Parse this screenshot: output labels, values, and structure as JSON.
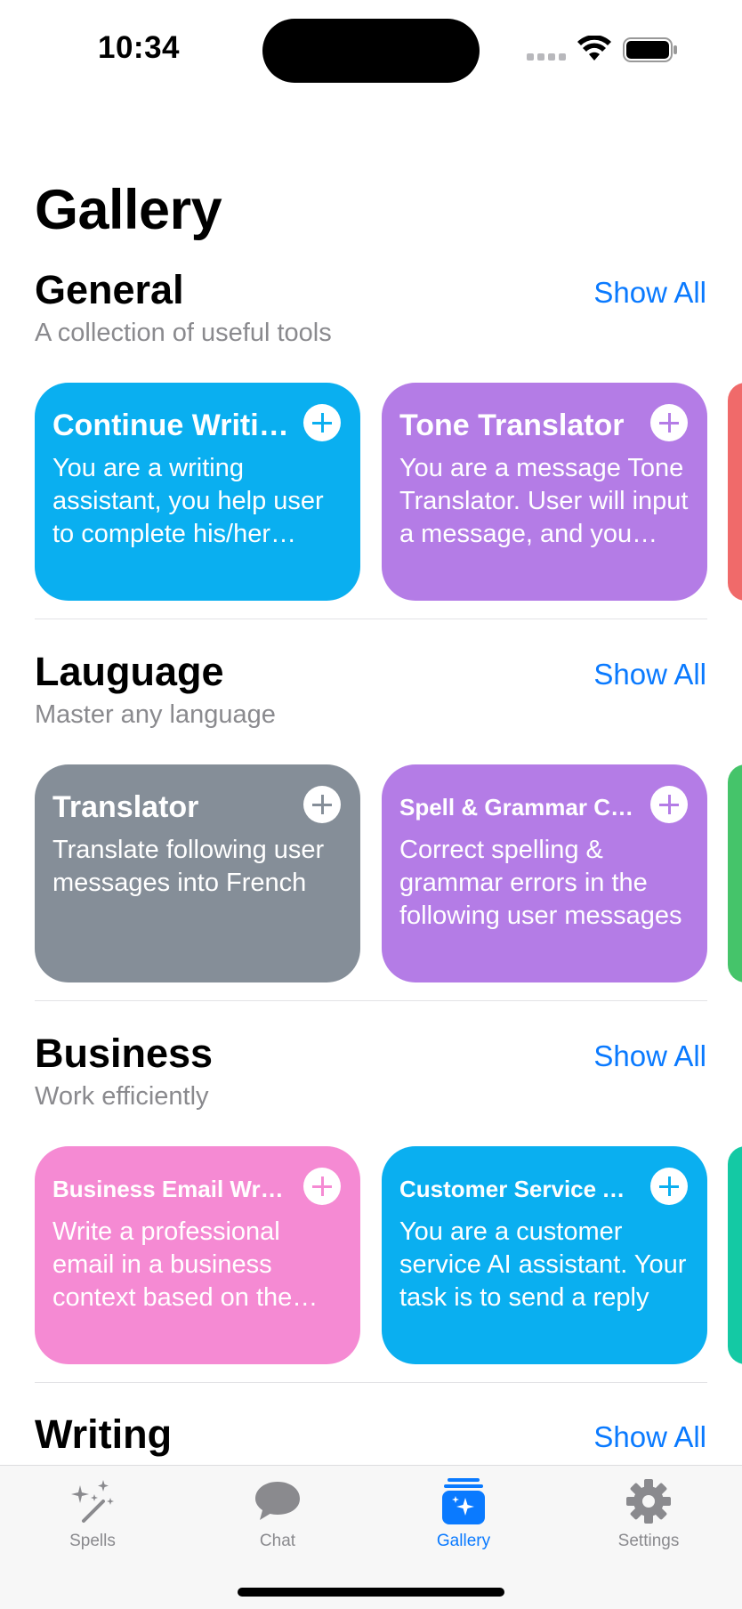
{
  "status": {
    "time": "10:34"
  },
  "page": {
    "title": "Gallery"
  },
  "sections": [
    {
      "title": "General",
      "subtitle": "A collection of useful tools",
      "show_all": "Show All",
      "cards": [
        {
          "title": "Continue Writing",
          "body": "You are a writing assistant, you help user to complete his/her writing",
          "color": "#0aaff0"
        },
        {
          "title": "Tone Translator",
          "body": "You are a message Tone Translator. User will input a message, and you translate it",
          "color": "#b47ce6"
        }
      ],
      "peek_color": "#f06a6a"
    },
    {
      "title": "Lauguage",
      "subtitle": "Master any language",
      "show_all": "Show All",
      "cards": [
        {
          "title": "Translator",
          "body": "Translate following user messages into French",
          "color": "#858e98"
        },
        {
          "title": "Spell & Grammar Checker",
          "body": "Correct spelling & grammar errors in the following user messages",
          "color": "#b47ce6"
        }
      ],
      "peek_color": "#45c46a"
    },
    {
      "title": "Business",
      "subtitle": "Work efficiently",
      "show_all": "Show All",
      "cards": [
        {
          "title": "Business Email Writer",
          "body": "Write a professional email in a business context based on the user input",
          "color": "#f58ad3"
        },
        {
          "title": "Customer Service Assistant",
          "body": "You are a customer service AI assistant. Your task is to send a reply",
          "color": "#0aaff0"
        }
      ],
      "peek_color": "#14c9a4"
    },
    {
      "title": "Writing",
      "show_all": "Show All"
    }
  ],
  "tabs": [
    {
      "label": "Spells",
      "icon": "sparkles-wand-icon",
      "active": false
    },
    {
      "label": "Chat",
      "icon": "chat-bubble-icon",
      "active": false
    },
    {
      "label": "Gallery",
      "icon": "gallery-icon",
      "active": true
    },
    {
      "label": "Settings",
      "icon": "gear-icon",
      "active": false
    }
  ],
  "colors": {
    "accent": "#0a7aff",
    "inactive": "#8a8a8e"
  }
}
